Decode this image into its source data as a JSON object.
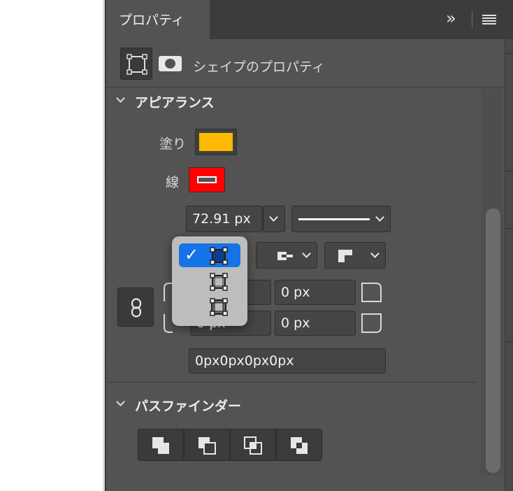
{
  "header": {
    "tab_label": "プロパティ",
    "collapse_glyph": "»",
    "menu_icon": "hamburger-menu-icon"
  },
  "kind": {
    "label": "シェイプのプロパティ",
    "icons": [
      "bounding-box-icon",
      "shape-pill-icon"
    ]
  },
  "appearance": {
    "title": "アピアランス",
    "fill_label": "塗り",
    "fill_color": "#FFB900",
    "stroke_label": "線",
    "stroke_color": "#FF0000",
    "stroke_width": "72.91 px",
    "stroke_style": "solid-line",
    "align_menu": {
      "options": [
        "align-inside-icon",
        "align-center-icon",
        "align-outside-icon"
      ],
      "selected_index": 0,
      "check_glyph": "✓"
    },
    "cap_icon": "cap-type-icon",
    "join_icon": "join-type-icon",
    "corners": {
      "top_left": "0 px",
      "top_right": "0 px",
      "bottom_left": "0 px",
      "bottom_right": "0 px",
      "summary": "0px0px0px0px"
    },
    "link_icon": "link-icon"
  },
  "pathfinder": {
    "title": "パスファインダー",
    "buttons": [
      "unite-icon",
      "subtract-icon",
      "intersect-icon",
      "exclude-icon"
    ]
  },
  "colors": {
    "panel_bg": "#535353",
    "menu_highlight": "#1473E6"
  }
}
